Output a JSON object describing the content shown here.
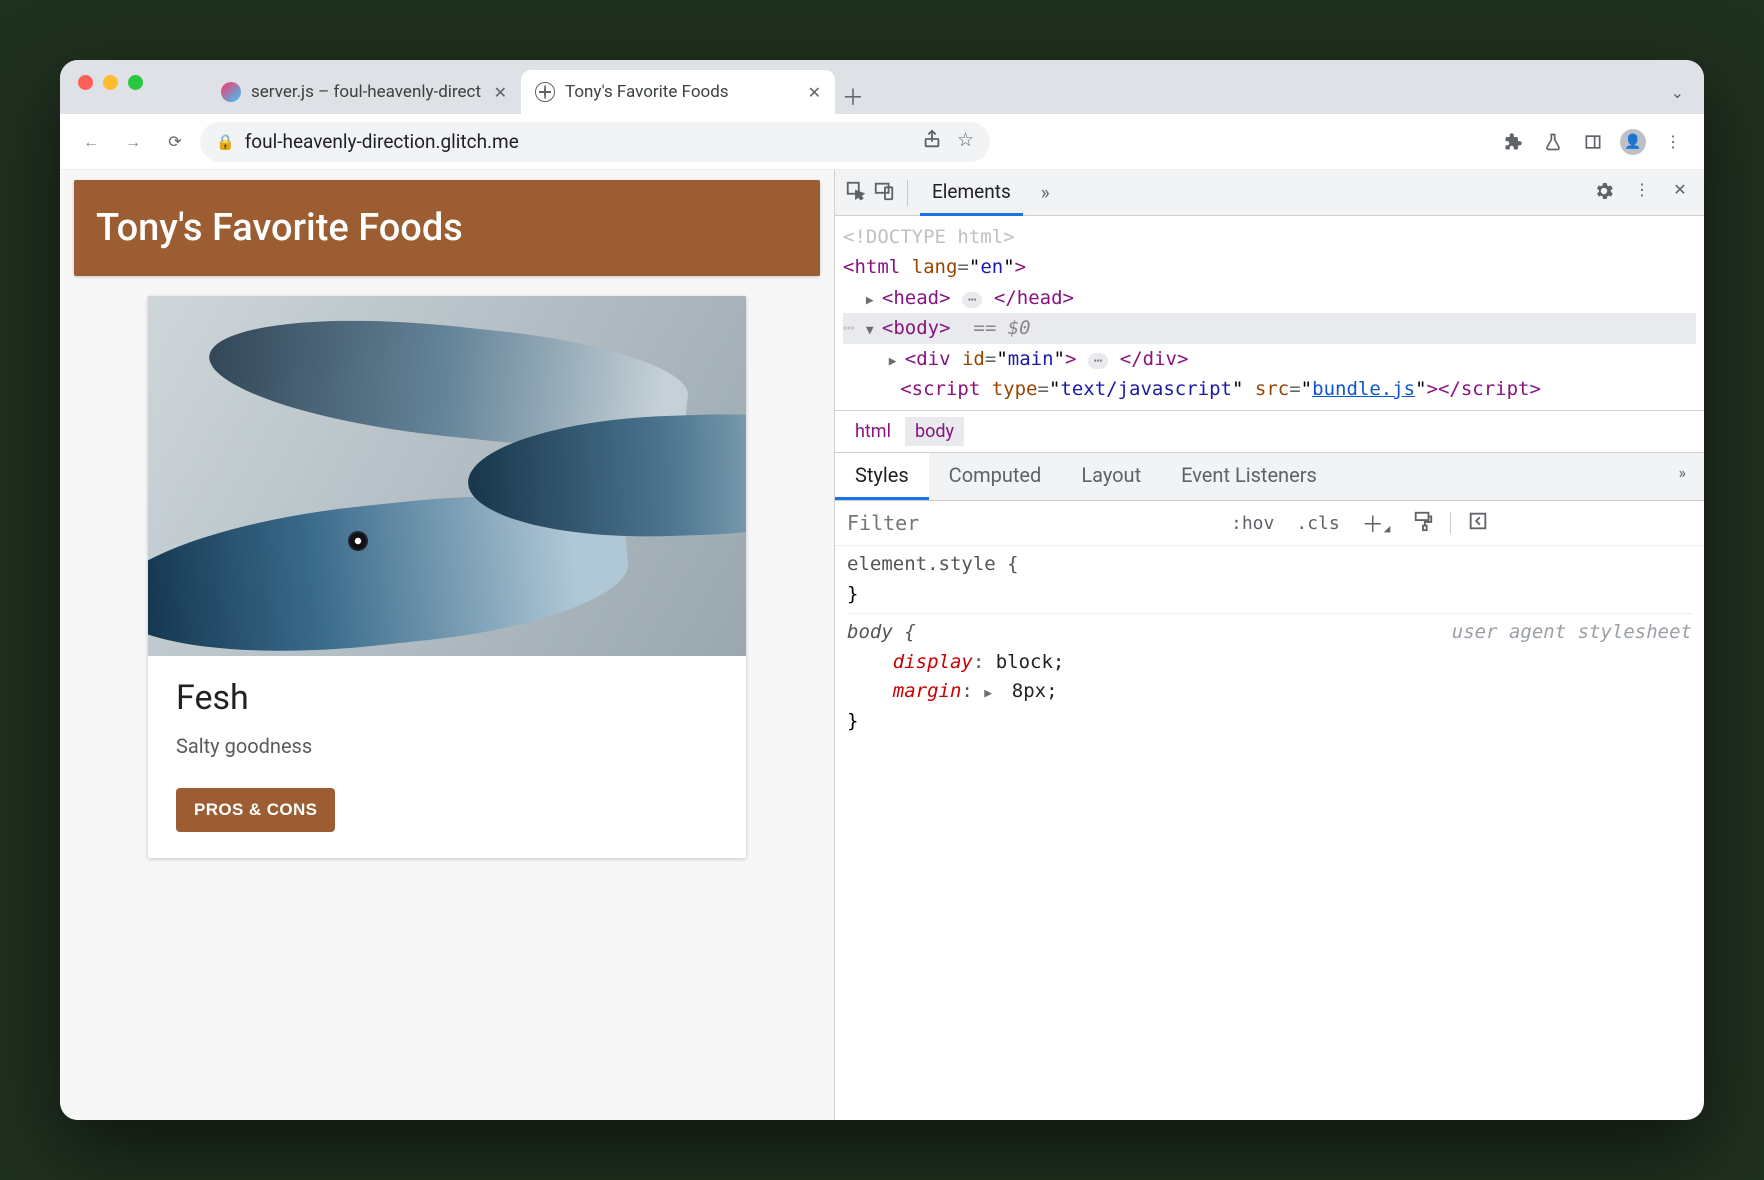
{
  "browser": {
    "tabs": [
      {
        "label": "server.js – foul-heavenly-direct",
        "active": false
      },
      {
        "label": "Tony's Favorite Foods",
        "active": true
      }
    ],
    "url": "foul-heavenly-direction.glitch.me"
  },
  "page": {
    "banner": "Tony's Favorite Foods",
    "card": {
      "title": "Fesh",
      "desc": "Salty goodness",
      "button": "PROS & CONS"
    }
  },
  "devtools": {
    "top_tab": "Elements",
    "dom": {
      "doctype": "<!DOCTYPE html>",
      "html_open": "<html lang=\"en\">",
      "head": "<head>",
      "head_close": "</head>",
      "body": "<body>",
      "selected_marker": "== $0",
      "div_open": "<div id=\"main\">",
      "div_close": "</div>",
      "script_open_a": "<script type=\"text/javascript\" src=\"",
      "script_src": "bundle.js",
      "script_open_b": "\">",
      "script_close": "</script>"
    },
    "breadcrumbs": [
      "html",
      "body"
    ],
    "styles_tabs": [
      "Styles",
      "Computed",
      "Layout",
      "Event Listeners"
    ],
    "filter_placeholder": "Filter",
    "toolbar": {
      "hov": ":hov",
      "cls": ".cls"
    },
    "rules": {
      "element_style": "element.style {",
      "close": "}",
      "body_sel": "body {",
      "ua_note": "user agent stylesheet",
      "props": [
        {
          "name": "display",
          "value": "block;"
        },
        {
          "name": "margin",
          "value": "8px;",
          "expand": true
        }
      ]
    }
  }
}
